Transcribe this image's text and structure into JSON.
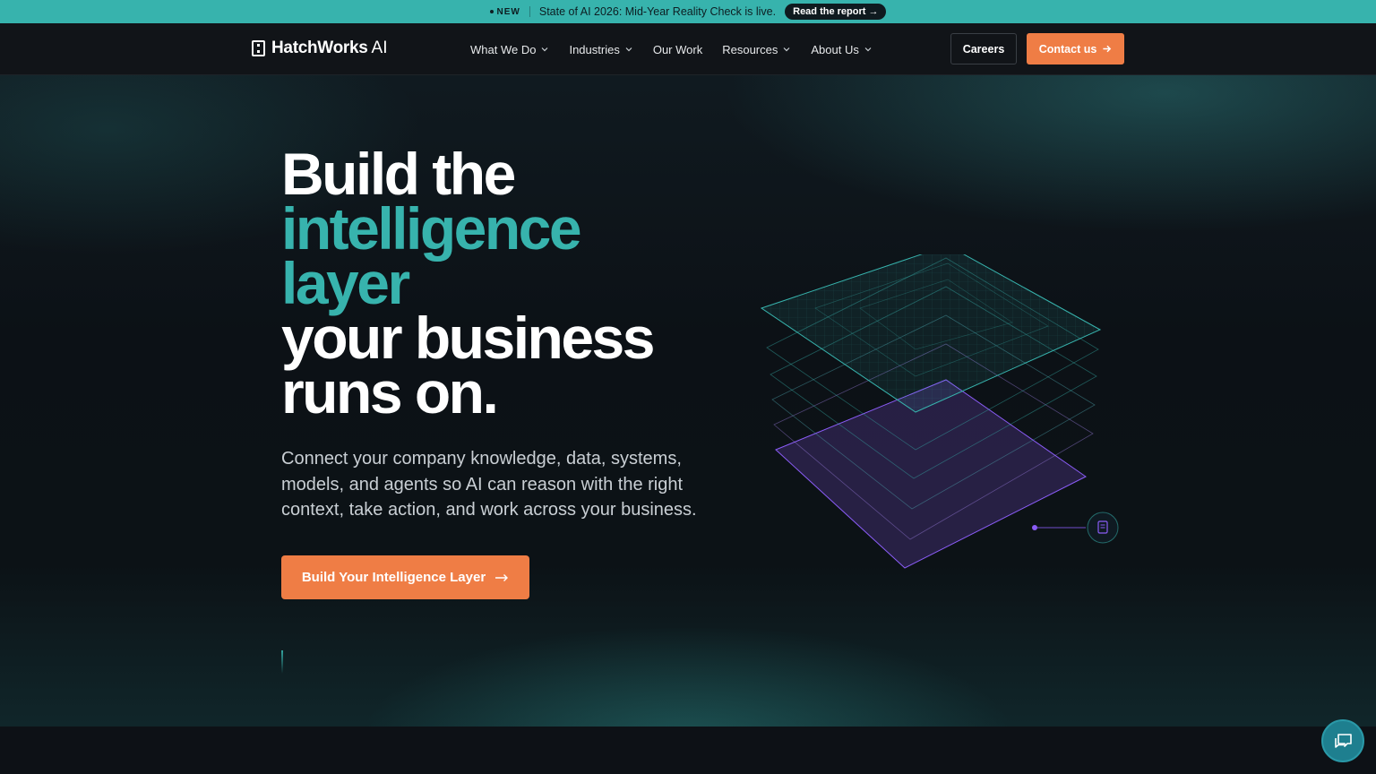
{
  "announcement": {
    "badge": "NEW",
    "text": "State of AI 2026: Mid-Year Reality Check is live.",
    "link_label": "Read the report →"
  },
  "nav": {
    "logo": {
      "brand": "HatchWorks",
      "suffix": "AI"
    },
    "items": [
      {
        "label": "What We Do",
        "has_dropdown": true
      },
      {
        "label": "Industries",
        "has_dropdown": true
      },
      {
        "label": "Our Work",
        "has_dropdown": false
      },
      {
        "label": "Resources",
        "has_dropdown": true
      },
      {
        "label": "About Us",
        "has_dropdown": true
      }
    ],
    "careers_label": "Careers",
    "contact_label": "Contact us"
  },
  "hero": {
    "headline": {
      "line1": "Build the",
      "line2": "intelligence",
      "line3": "layer",
      "line4": "your business",
      "line5": "runs on."
    },
    "subtext": "Connect your company knowledge, data, systems, models, and agents so AI can reason with the right context, take action, and work across your business.",
    "cta_label": "Build Your Intelligence Layer"
  },
  "colors": {
    "accent_teal": "#37b3ad",
    "accent_orange": "#ef7d45",
    "accent_purple": "#8a5cf6",
    "background": "#0d1117"
  },
  "icons": {
    "chat": "chat-bubbles-icon",
    "document": "document-icon",
    "arrow": "arrow-right-icon",
    "chevron": "chevron-down-icon"
  }
}
